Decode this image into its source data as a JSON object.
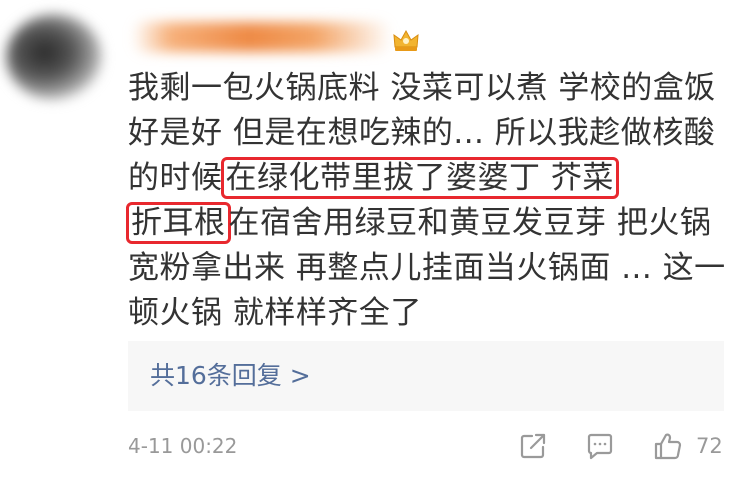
{
  "comment": {
    "segments": [
      {
        "text": "我剩一包火锅底料  没菜可以煮 学校的盒饭好是好 但是在想吃辣的... 所以我趁做核酸的时候",
        "highlight": false
      },
      {
        "text": "在绿化带里拔了婆婆丁 芥菜",
        "highlight": true
      },
      {
        "text": "折耳根",
        "highlight": true
      },
      {
        "text": "在宿舍用绿豆和黄豆发豆芽  把火锅宽粉拿出来  再整点儿挂面当火锅面 ... 这一顿火锅 就样样齐全了",
        "highlight": false
      }
    ],
    "highlight_color": "#e8282e"
  },
  "replies": {
    "label": "共16条回复 >"
  },
  "footer": {
    "time": "4-11 00:22",
    "like_count": "72",
    "icons": [
      "share-icon",
      "comment-icon",
      "like-icon"
    ]
  },
  "header": {
    "badge_icon": "crown-icon"
  }
}
